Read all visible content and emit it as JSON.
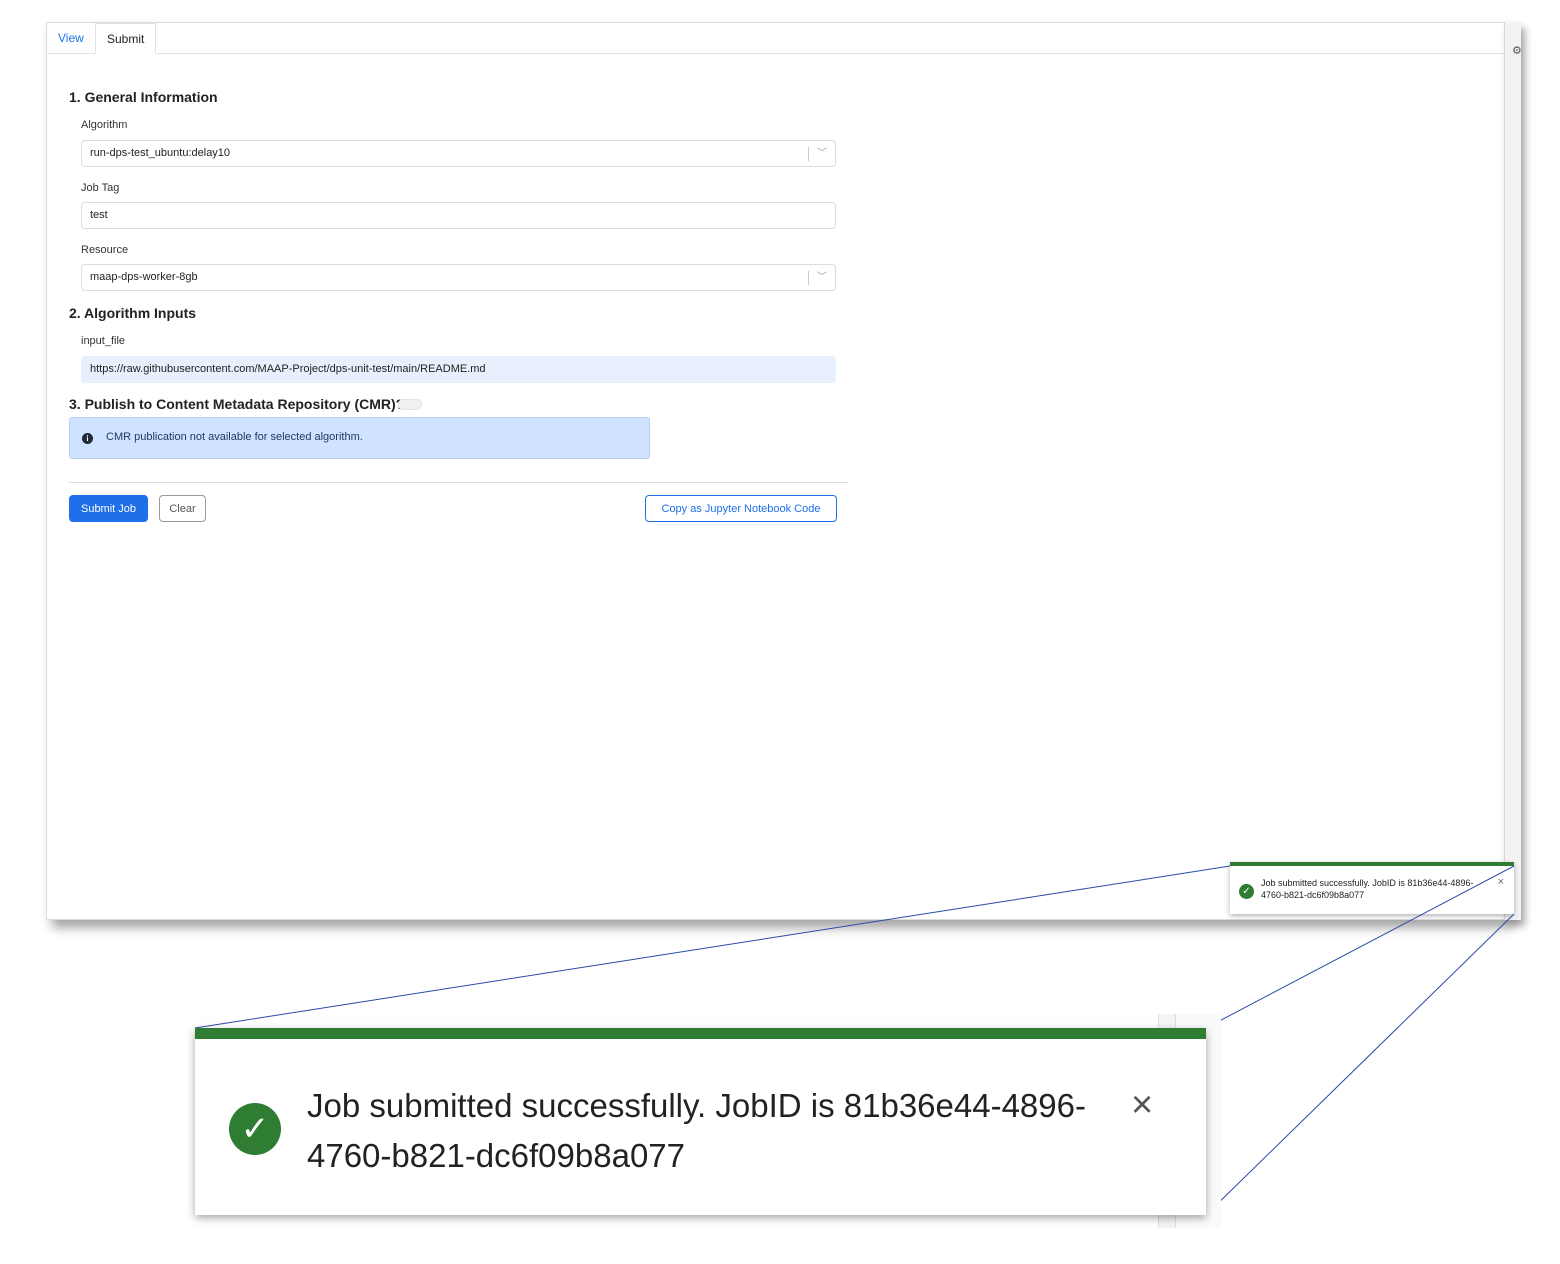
{
  "tabs": [
    {
      "label": "View",
      "active": false
    },
    {
      "label": "Submit",
      "active": true
    }
  ],
  "sections": {
    "general": {
      "title": "1. General Information",
      "algorithm": {
        "label": "Algorithm",
        "value": "run-dps-test_ubuntu:delay10"
      },
      "job_tag": {
        "label": "Job Tag",
        "value": "test"
      },
      "resource": {
        "label": "Resource",
        "value": "maap-dps-worker-8gb"
      }
    },
    "inputs": {
      "title": "2. Algorithm Inputs",
      "input_file": {
        "label": "input_file",
        "value": "https://raw.githubusercontent.com/MAAP-Project/dps-unit-test/main/README.md"
      }
    },
    "publish": {
      "title": "3. Publish to Content Metadata Repository (CMR)?",
      "toggle_on": false,
      "info": "CMR publication not available for selected algorithm."
    }
  },
  "actions": {
    "submit_label": "Submit Job",
    "clear_label": "Clear",
    "copy_label": "Copy as Jupyter Notebook Code"
  },
  "toast": {
    "message": "Job submitted successfully. JobID is 81b36e44-4896-4760-b821-dc6f09b8a077",
    "close_glyph": "×"
  },
  "icons": {
    "check": "✓",
    "info": "i",
    "chevron": "﹀",
    "gear": "⚙"
  },
  "colors": {
    "primary": "#1f6feb",
    "success": "#2e7d32",
    "info_bg": "#cfe2ff",
    "filled_input_bg": "#e8f0fe"
  }
}
